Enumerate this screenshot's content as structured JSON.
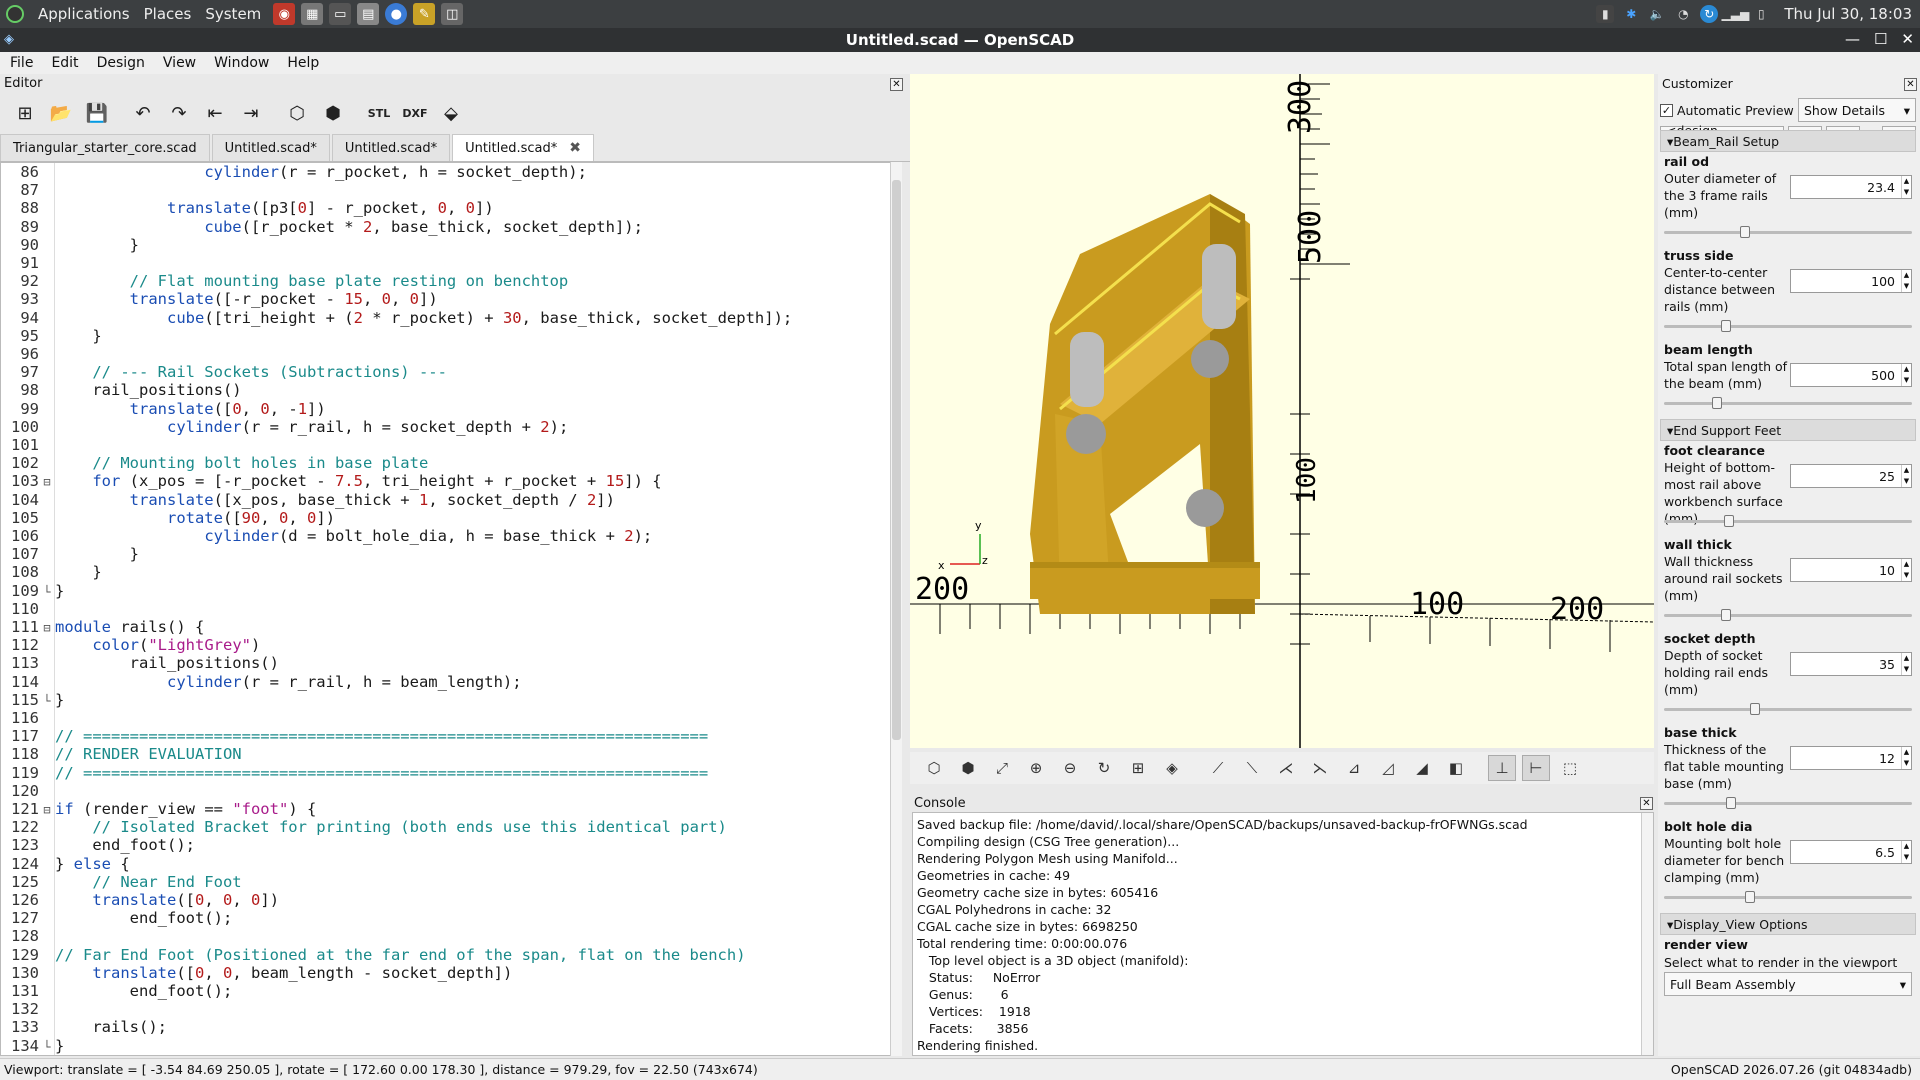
{
  "top_panel": {
    "menus": [
      "Applications",
      "Places",
      "System"
    ],
    "clock": "Thu Jul 30, 18:03"
  },
  "window": {
    "title": "Untitled.scad — OpenSCAD"
  },
  "menubar": [
    "File",
    "Edit",
    "Design",
    "View",
    "Window",
    "Help"
  ],
  "editor": {
    "label": "Editor",
    "toolbar_labels": {
      "stl": "STL",
      "dxf": "DXF"
    },
    "tabs": [
      {
        "label": "Triangular_starter_core.scad",
        "active": false
      },
      {
        "label": "Untitled.scad*",
        "active": false
      },
      {
        "label": "Untitled.scad*",
        "active": false
      },
      {
        "label": "Untitled.scad*",
        "active": true
      }
    ],
    "lines": [
      {
        "n": "86",
        "text": "                cylinder(r = r_pocket, h = socket_depth);"
      },
      {
        "n": "87",
        "text": ""
      },
      {
        "n": "88",
        "text": "            translate([p3[0] - r_pocket, 0, 0])"
      },
      {
        "n": "89",
        "text": "                cube([r_pocket * 2, base_thick, socket_depth]);"
      },
      {
        "n": "90",
        "text": "        }"
      },
      {
        "n": "91",
        "text": ""
      },
      {
        "n": "92",
        "text": "        // Flat mounting base plate resting on benchtop"
      },
      {
        "n": "93",
        "text": "        translate([-r_pocket - 15, 0, 0])"
      },
      {
        "n": "94",
        "text": "            cube([tri_height + (2 * r_pocket) + 30, base_thick, socket_depth]);"
      },
      {
        "n": "95",
        "text": "    }"
      },
      {
        "n": "96",
        "text": ""
      },
      {
        "n": "97",
        "text": "    // --- Rail Sockets (Subtractions) ---"
      },
      {
        "n": "98",
        "text": "    rail_positions()"
      },
      {
        "n": "99",
        "text": "        translate([0, 0, -1])"
      },
      {
        "n": "100",
        "text": "            cylinder(r = r_rail, h = socket_depth + 2);"
      },
      {
        "n": "101",
        "text": ""
      },
      {
        "n": "102",
        "text": "    // Mounting bolt holes in base plate"
      },
      {
        "n": "103",
        "text": "    for (x_pos = [-r_pocket - 7.5, tri_height + r_pocket + 15]) {"
      },
      {
        "n": "104",
        "text": "        translate([x_pos, base_thick + 1, socket_depth / 2])"
      },
      {
        "n": "105",
        "text": "            rotate([90, 0, 0])"
      },
      {
        "n": "106",
        "text": "                cylinder(d = bolt_hole_dia, h = base_thick + 2);"
      },
      {
        "n": "107",
        "text": "        }"
      },
      {
        "n": "108",
        "text": "    }"
      },
      {
        "n": "109",
        "text": "}"
      },
      {
        "n": "110",
        "text": ""
      },
      {
        "n": "111",
        "text": "module rails() {"
      },
      {
        "n": "112",
        "text": "    color(\"LightGrey\")"
      },
      {
        "n": "113",
        "text": "        rail_positions()"
      },
      {
        "n": "114",
        "text": "            cylinder(r = r_rail, h = beam_length);"
      },
      {
        "n": "115",
        "text": "}"
      },
      {
        "n": "116",
        "text": ""
      },
      {
        "n": "117",
        "text": "// ==================================================================="
      },
      {
        "n": "118",
        "text": "// RENDER EVALUATION"
      },
      {
        "n": "119",
        "text": "// ==================================================================="
      },
      {
        "n": "120",
        "text": ""
      },
      {
        "n": "121",
        "text": "if (render_view == \"foot\") {"
      },
      {
        "n": "122",
        "text": "    // Isolated Bracket for printing (both ends use this identical part)"
      },
      {
        "n": "123",
        "text": "    end_foot();"
      },
      {
        "n": "124",
        "text": "} else {"
      },
      {
        "n": "125",
        "text": "    // Near End Foot"
      },
      {
        "n": "126",
        "text": "    translate([0, 0, 0])"
      },
      {
        "n": "127",
        "text": "        end_foot();"
      },
      {
        "n": "128",
        "text": ""
      },
      {
        "n": "129",
        "text": "// Far End Foot (Positioned at the far end of the span, flat on the bench)"
      },
      {
        "n": "130",
        "text": "    translate([0, 0, beam_length - socket_depth])"
      },
      {
        "n": "131",
        "text": "        end_foot();"
      },
      {
        "n": "132",
        "text": ""
      },
      {
        "n": "133",
        "text": "    rails();"
      },
      {
        "n": "134",
        "text": "}"
      }
    ]
  },
  "viewport": {
    "axis_labels": {
      "ytop": "300",
      "y500": "500",
      "z100": "100",
      "x_neg200": "200",
      "x_neg100": "100",
      "x100": "100",
      "x200": "200",
      "xaxis": "x",
      "yaxis": "y",
      "zaxis": "z"
    },
    "colors": {
      "background": "#ffffe5",
      "part": "#d4a829",
      "part_dark": "#b38b16",
      "rail": "#bdbdbd",
      "edge_highlight": "#f4e04d"
    }
  },
  "console": {
    "label": "Console",
    "lines": [
      "Saved backup file: /home/david/.local/share/OpenSCAD/backups/unsaved-backup-frOFWNGs.scad",
      "Compiling design (CSG Tree generation)...",
      "Rendering Polygon Mesh using Manifold...",
      "Geometries in cache: 49",
      "Geometry cache size in bytes: 605416",
      "CGAL Polyhedrons in cache: 32",
      "CGAL cache size in bytes: 6698250",
      "Total rendering time: 0:00:00.076",
      "   Top level object is a 3D object (manifold):",
      "   Status:     NoError",
      "   Genus:       6",
      "   Vertices:    1918",
      "   Facets:      3856",
      "Rendering finished."
    ]
  },
  "customizer": {
    "label": "Customizer",
    "automatic_preview": "Automatic Preview",
    "show_details": "Show Details",
    "preset": "<design default>",
    "add_btn": "+",
    "remove_btn": "-",
    "more_btn": "...",
    "sections": [
      {
        "title": "Beam_Rail Setup",
        "params": [
          {
            "name": "rail od",
            "desc": "Outer diameter of the 3 frame rails (mm)",
            "value": "23.4",
            "fraction": 0.32
          },
          {
            "name": "truss side",
            "desc": "Center-to-center distance between rails (mm)",
            "value": "100",
            "fraction": 0.24
          },
          {
            "name": "beam length",
            "desc": "Total span length of the beam (mm)",
            "value": "500",
            "fraction": 0.2
          }
        ]
      },
      {
        "title": "End Support Feet",
        "params": [
          {
            "name": "foot clearance",
            "desc": "Height of bottom-most rail above workbench surface (mm)",
            "value": "25",
            "fraction": 0.25
          },
          {
            "name": "wall thick",
            "desc": "Wall thickness around rail sockets (mm)",
            "value": "10",
            "fraction": 0.24
          },
          {
            "name": "socket depth",
            "desc": "Depth of socket holding rail ends (mm)",
            "value": "35",
            "fraction": 0.36
          },
          {
            "name": "base thick",
            "desc": "Thickness of the flat table mounting base (mm)",
            "value": "12",
            "fraction": 0.26
          },
          {
            "name": "bolt hole dia",
            "desc": "Mounting bolt hole diameter for bench clamping (mm)",
            "value": "6.5",
            "fraction": 0.34
          }
        ]
      },
      {
        "title": "Display_View Options",
        "params": [
          {
            "name": "render view",
            "desc": "Select what to render in the viewport",
            "select": "Full Beam Assembly"
          }
        ]
      }
    ]
  },
  "statusbar": {
    "viewport": "Viewport: translate = [ -3.54 84.69 250.05 ], rotate = [ 172.60 0.00 178.30 ], distance = 979.29, fov = 22.50 (743x674)",
    "version": "OpenSCAD 2026.07.26 (git 04834adb)"
  }
}
